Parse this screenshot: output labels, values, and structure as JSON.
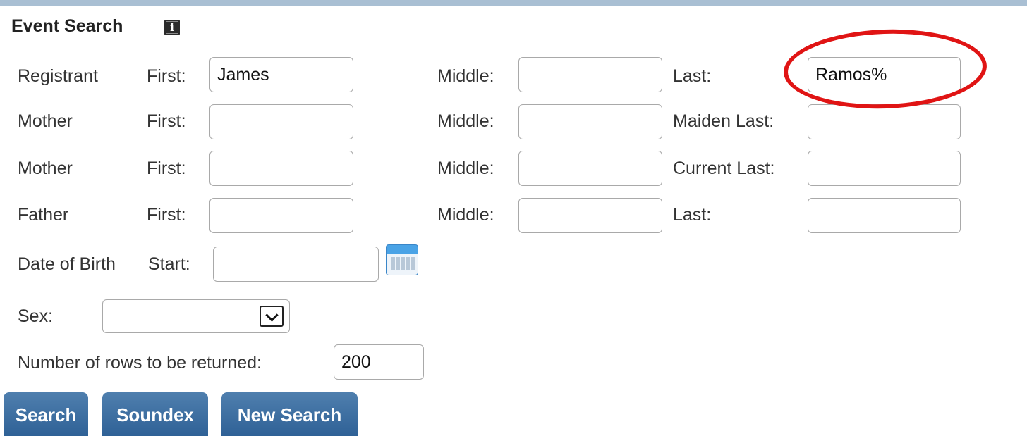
{
  "panel": {
    "title": "Event Search",
    "info_icon": "info-icon"
  },
  "rows": [
    {
      "role": "Registrant",
      "first_label": "First:",
      "first_value": "James",
      "middle_label": "Middle:",
      "middle_value": "",
      "last_label": "Last:",
      "last_value": "Ramos%"
    },
    {
      "role": "Mother",
      "first_label": "First:",
      "first_value": "",
      "middle_label": "Middle:",
      "middle_value": "",
      "last_label": "Maiden Last:",
      "last_value": ""
    },
    {
      "role": "Mother",
      "first_label": "First:",
      "first_value": "",
      "middle_label": "Middle:",
      "middle_value": "",
      "last_label": "Current Last:",
      "last_value": ""
    },
    {
      "role": "Father",
      "first_label": "First:",
      "first_value": "",
      "middle_label": "Middle:",
      "middle_value": "",
      "last_label": "Last:",
      "last_value": ""
    }
  ],
  "dob": {
    "label": "Date of Birth",
    "start_label": "Start:",
    "start_value": "",
    "calendar_icon": "calendar-icon"
  },
  "sex": {
    "label": "Sex:",
    "selected": "",
    "dropdown_icon": "chevron-down-icon"
  },
  "rows_returned": {
    "label": "Number of rows to be returned:",
    "value": "200"
  },
  "buttons": {
    "search": "Search",
    "soundex": "Soundex",
    "new_search": "New Search"
  },
  "colors": {
    "button": "#3a6a9c",
    "top_rule": "#a9bfd3",
    "annotation": "#e01414"
  }
}
